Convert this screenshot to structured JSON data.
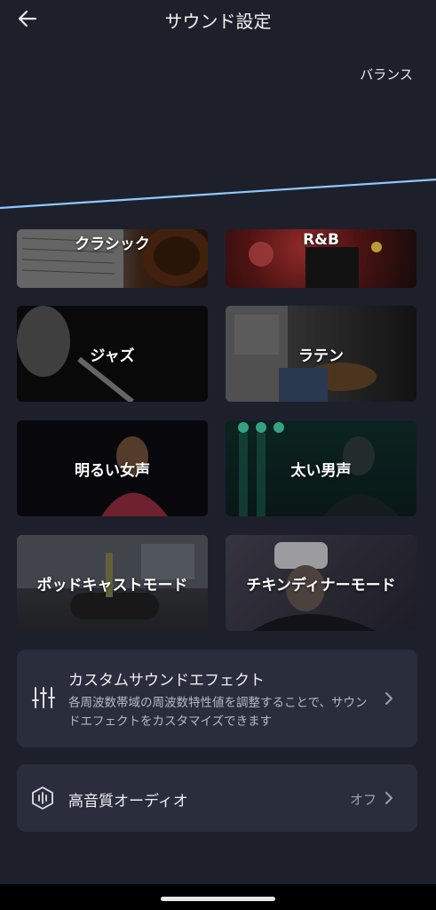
{
  "header": {
    "title": "サウンド設定"
  },
  "equalizer": {
    "balance_label": "バランス"
  },
  "presets": [
    {
      "label": "クラシック"
    },
    {
      "label": "R&B"
    },
    {
      "label": "ジャズ"
    },
    {
      "label": "ラテン"
    },
    {
      "label": "明るい女声"
    },
    {
      "label": "太い男声"
    },
    {
      "label": "ポッドキャストモード"
    },
    {
      "label": "チキンディナーモード"
    }
  ],
  "custom_effect": {
    "title": "カスタムサウンドエフェクト",
    "description": "各周波数帯域の周波数特性値を調整することで、サウンドエフェクトをカスタマイズできます"
  },
  "hq_audio": {
    "title": "高音質オーディオ",
    "status": "オフ"
  },
  "colors": {
    "background": "#1d202b",
    "panel": "#2a2e3c",
    "eq_line": "#8fc8ff"
  }
}
